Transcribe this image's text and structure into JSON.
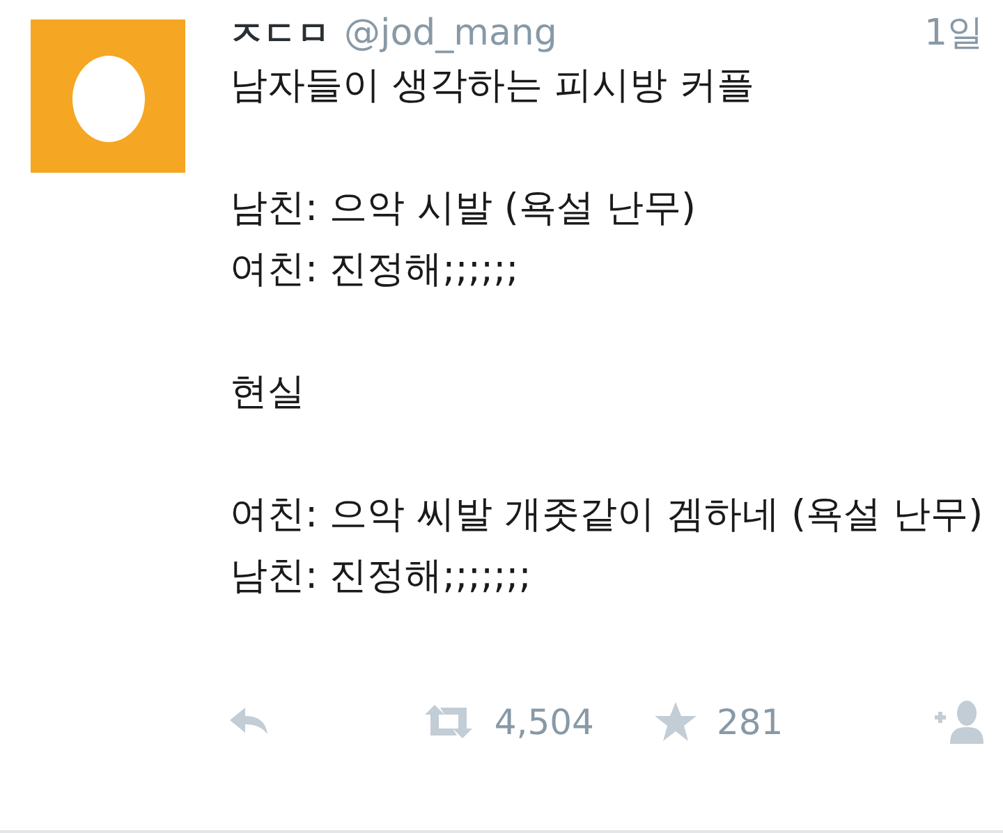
{
  "tweet": {
    "avatar": {
      "kind": "egg"
    },
    "name": "ㅈㄷㅁ",
    "handle": "@jod_mang",
    "time": "1일",
    "paragraphs": [
      [
        "남자들이 생각하는 피시방 커플"
      ],
      [
        "남친: 으악 시발 (욕설 난무)",
        "여친: 진정해;;;;;;"
      ],
      [
        "현실"
      ],
      [
        "여친: 으악 씨발 개좃같이 겜하네 (욕설 난무)",
        "남친: 진정해;;;;;;;"
      ]
    ],
    "actions": [
      {
        "kind": "reply"
      },
      {
        "kind": "retweet",
        "count": "4,504"
      },
      {
        "kind": "favorite",
        "count": "281"
      },
      {
        "kind": "follow"
      }
    ]
  }
}
